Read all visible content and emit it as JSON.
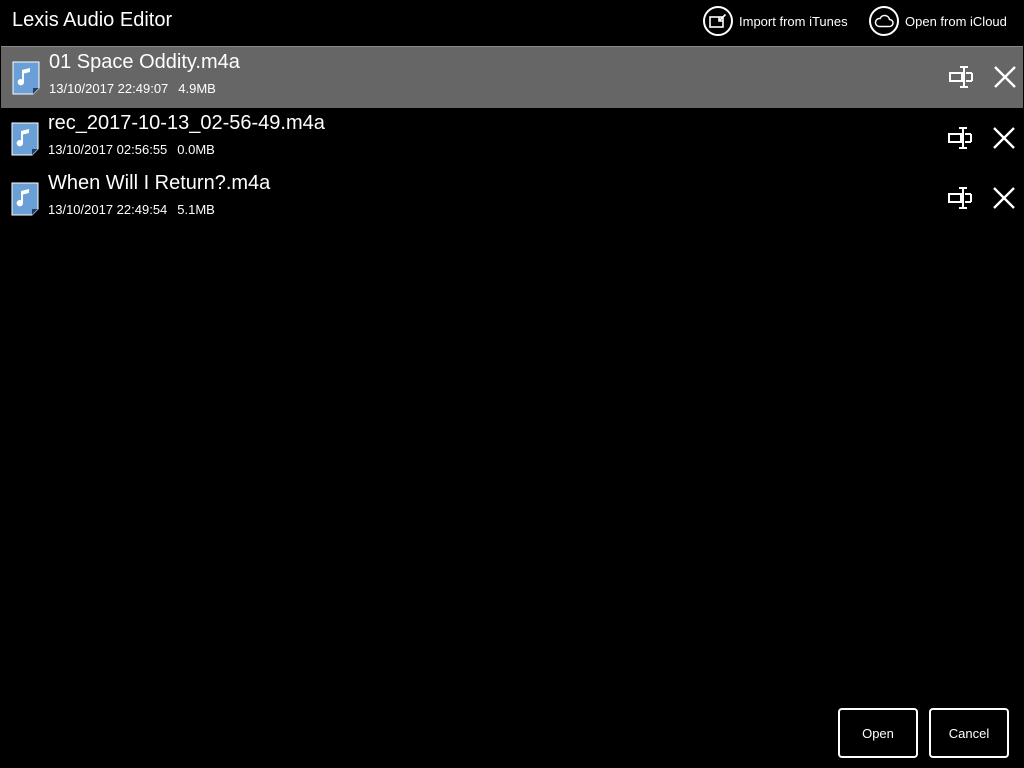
{
  "app": {
    "title": "Lexis Audio Editor"
  },
  "header": {
    "import_label": "Import from iTunes",
    "import_icon": "import-arrow-icon",
    "icloud_label": "Open from iCloud",
    "icloud_icon": "cloud-icon"
  },
  "files": [
    {
      "name": "01 Space Oddity.m4a",
      "date": "13/10/2017 22:49:07",
      "size": "4.9MB",
      "selected": true
    },
    {
      "name": "rec_2017-10-13_02-56-49.m4a",
      "date": "13/10/2017 02:56:55",
      "size": "0.0MB",
      "selected": false
    },
    {
      "name": "When Will I Return?.m4a",
      "date": "13/10/2017 22:49:54",
      "size": "5.1MB",
      "selected": false
    }
  ],
  "footer": {
    "open_label": "Open",
    "cancel_label": "Cancel"
  },
  "colors": {
    "background": "#000000",
    "selected_row": "#666666",
    "text": "#ffffff",
    "file_icon": "#6a9fd8"
  }
}
